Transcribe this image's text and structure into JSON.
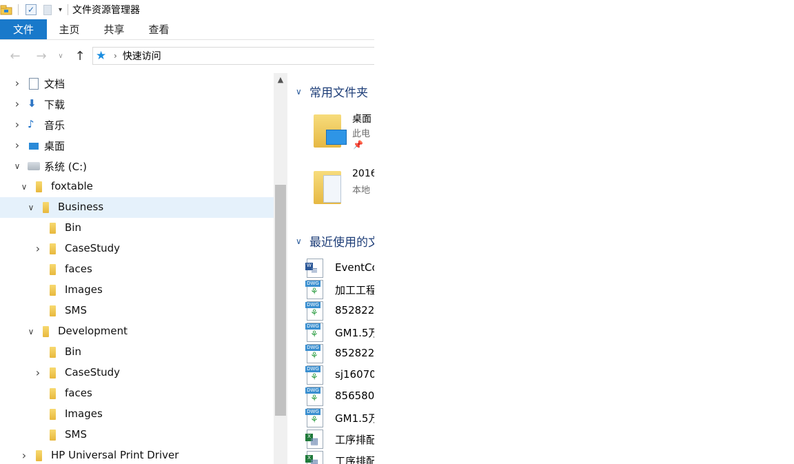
{
  "window": {
    "title": "文件资源管理器"
  },
  "quick_access_toolbar": {
    "dropdown_glyph": "▾"
  },
  "ribbon": {
    "file_tab": "文件",
    "tabs": [
      "主页",
      "共享",
      "查看"
    ]
  },
  "navigation": {
    "back_glyph": "←",
    "forward_glyph": "→",
    "recent_glyph": "∨",
    "up_glyph": "↑",
    "address_chevron": "›",
    "address_text": "快速访问"
  },
  "tree": {
    "items": [
      {
        "label": "文档",
        "icon": "documents-icon",
        "expanded": false
      },
      {
        "label": "下载",
        "icon": "downloads-icon",
        "expanded": false
      },
      {
        "label": "音乐",
        "icon": "music-icon",
        "expanded": false
      },
      {
        "label": "桌面",
        "icon": "desktop-icon",
        "expanded": false
      },
      {
        "label": "系统 (C:)",
        "icon": "drive-icon",
        "expanded": true
      },
      {
        "label": "foxtable",
        "icon": "folder-icon",
        "expanded": true
      },
      {
        "label": "Business",
        "icon": "folder-icon",
        "expanded": true,
        "selected": true
      },
      {
        "label": "Bin",
        "icon": "folder-icon"
      },
      {
        "label": "CaseStudy",
        "icon": "folder-icon",
        "expanded": false
      },
      {
        "label": "faces",
        "icon": "folder-icon"
      },
      {
        "label": "Images",
        "icon": "folder-icon"
      },
      {
        "label": "SMS",
        "icon": "folder-icon"
      },
      {
        "label": "Development",
        "icon": "folder-icon",
        "expanded": true
      },
      {
        "label": "Bin",
        "icon": "folder-icon"
      },
      {
        "label": "CaseStudy",
        "icon": "folder-icon",
        "expanded": false
      },
      {
        "label": "faces",
        "icon": "folder-icon"
      },
      {
        "label": "Images",
        "icon": "folder-icon"
      },
      {
        "label": "SMS",
        "icon": "folder-icon"
      },
      {
        "label": "HP Universal Print Driver",
        "icon": "folder-icon",
        "expanded": false
      }
    ]
  },
  "content": {
    "frequent_section_title": "常用文件夹",
    "frequent_folders": [
      {
        "name": "桌面",
        "sub": "此电",
        "pinned": true
      },
      {
        "name": "2016",
        "sub": "本地"
      }
    ],
    "recent_section_title": "最近使用的文",
    "recent_files": [
      {
        "name": "EventCo",
        "type": "doc"
      },
      {
        "name": "加工工程",
        "type": "dwg"
      },
      {
        "name": "852822-",
        "type": "dwg"
      },
      {
        "name": "GM1.5万",
        "type": "dwg"
      },
      {
        "name": "852822-",
        "type": "dwg"
      },
      {
        "name": "sj16070",
        "type": "dwg"
      },
      {
        "name": "856580-",
        "type": "dwg"
      },
      {
        "name": "GM1.5万",
        "type": "dwg"
      },
      {
        "name": "工序排配",
        "type": "xls"
      },
      {
        "name": "工序排配",
        "type": "xls"
      }
    ]
  },
  "colors": {
    "accent": "#1979ca",
    "selection": "#e5f1fb",
    "section_title": "#1e3e78"
  }
}
